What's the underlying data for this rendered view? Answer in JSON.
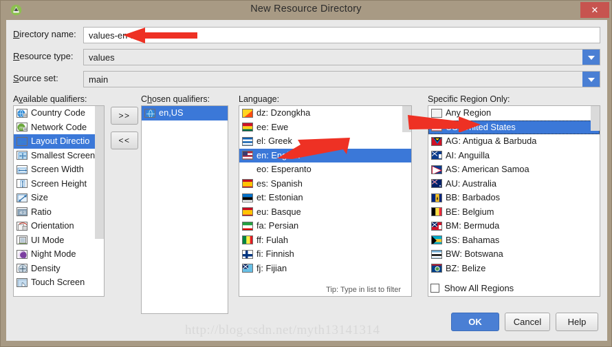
{
  "window": {
    "title": "New Resource Directory",
    "app_icon": "android-studio-icon",
    "close_label": "✕"
  },
  "form": {
    "directory_name": {
      "label": "Directory name:",
      "mnemonic": "D",
      "value": "values-en-rUS"
    },
    "resource_type": {
      "label": "Resource type:",
      "mnemonic": "R",
      "value": "values"
    },
    "source_set": {
      "label": "Source set:",
      "mnemonic": "S",
      "value": "main"
    }
  },
  "available_qualifiers": {
    "caption": "Available qualifiers:",
    "mnemonic": "v",
    "items": [
      {
        "label": "Country Code",
        "icon": "globe-badge-icon",
        "selected": false
      },
      {
        "label": "Network Code",
        "icon": "network-badge-icon",
        "selected": false
      },
      {
        "label": "Layout Directio",
        "icon": "layout-direction-icon",
        "selected": true
      },
      {
        "label": "Smallest Screen",
        "icon": "smallest-screen-icon",
        "selected": false
      },
      {
        "label": "Screen Width",
        "icon": "screen-width-icon",
        "selected": false
      },
      {
        "label": "Screen Height",
        "icon": "screen-height-icon",
        "selected": false
      },
      {
        "label": "Size",
        "icon": "size-icon",
        "selected": false
      },
      {
        "label": "Ratio",
        "icon": "ratio-icon",
        "selected": false
      },
      {
        "label": "Orientation",
        "icon": "orientation-icon",
        "selected": false
      },
      {
        "label": "UI Mode",
        "icon": "ui-mode-icon",
        "selected": false
      },
      {
        "label": "Night Mode",
        "icon": "night-mode-icon",
        "selected": false
      },
      {
        "label": "Density",
        "icon": "density-icon",
        "selected": false
      },
      {
        "label": "Touch Screen",
        "icon": "touch-screen-icon",
        "selected": false
      }
    ]
  },
  "chosen_qualifiers": {
    "caption": "Chosen qualifiers:",
    "mnemonic": "h",
    "items": [
      {
        "label": "en,US",
        "icon": "globe-icon",
        "selected": true
      }
    ]
  },
  "transfer": {
    "add_label": ">>",
    "remove_label": "<<"
  },
  "language": {
    "caption": "Language:",
    "tip": "Tip: Type in list to filter",
    "items": [
      {
        "label": "dz: Dzongkha",
        "icon": "flag-bt-icon",
        "selected": false
      },
      {
        "label": "ee: Ewe",
        "icon": "flag-gh-icon",
        "selected": false
      },
      {
        "label": "el: Greek",
        "icon": "flag-gr-icon",
        "selected": false
      },
      {
        "label": "en: English",
        "icon": "flag-us-icon",
        "selected": true
      },
      {
        "label": "eo: Esperanto",
        "icon": "no-flag-icon",
        "selected": false
      },
      {
        "label": "es: Spanish",
        "icon": "flag-es-icon",
        "selected": false
      },
      {
        "label": "et: Estonian",
        "icon": "flag-ee-icon",
        "selected": false
      },
      {
        "label": "eu: Basque",
        "icon": "flag-es-icon",
        "selected": false
      },
      {
        "label": "fa: Persian",
        "icon": "flag-ir-icon",
        "selected": false
      },
      {
        "label": "ff: Fulah",
        "icon": "flag-sn-icon",
        "selected": false
      },
      {
        "label": "fi: Finnish",
        "icon": "flag-fi-icon",
        "selected": false
      },
      {
        "label": "fj: Fijian",
        "icon": "flag-fj-icon",
        "selected": false
      }
    ]
  },
  "region": {
    "caption": "Specific Region Only:",
    "show_all_label": "Show All Regions",
    "show_all_checked": false,
    "items": [
      {
        "label": "Any Region",
        "icon": "blank-flag-icon",
        "selected": false
      },
      {
        "label": "US: United States",
        "icon": "flag-us-icon",
        "selected": true
      },
      {
        "label": "AG: Antigua & Barbuda",
        "icon": "flag-ag-icon",
        "selected": false
      },
      {
        "label": "AI: Anguilla",
        "icon": "flag-ai-icon",
        "selected": false
      },
      {
        "label": "AS: American Samoa",
        "icon": "flag-as-icon",
        "selected": false
      },
      {
        "label": "AU: Australia",
        "icon": "flag-au-icon",
        "selected": false
      },
      {
        "label": "BB: Barbados",
        "icon": "flag-bb-icon",
        "selected": false
      },
      {
        "label": "BE: Belgium",
        "icon": "flag-be-icon",
        "selected": false
      },
      {
        "label": "BM: Bermuda",
        "icon": "flag-bm-icon",
        "selected": false
      },
      {
        "label": "BS: Bahamas",
        "icon": "flag-bs-icon",
        "selected": false
      },
      {
        "label": "BW: Botswana",
        "icon": "flag-bw-icon",
        "selected": false
      },
      {
        "label": "BZ: Belize",
        "icon": "flag-bz-icon",
        "selected": false
      }
    ]
  },
  "buttons": {
    "ok": "OK",
    "cancel": "Cancel",
    "help": "Help"
  },
  "watermark": "http://blog.csdn.net/myth13141314",
  "colors": {
    "titlebar": "#a89a84",
    "dialog_bg": "#e9e9e9",
    "selection": "#3b78d8",
    "accent_button": "#4a7fd4",
    "close_button": "#c7544f",
    "annotation_arrow": "#ee3124"
  }
}
